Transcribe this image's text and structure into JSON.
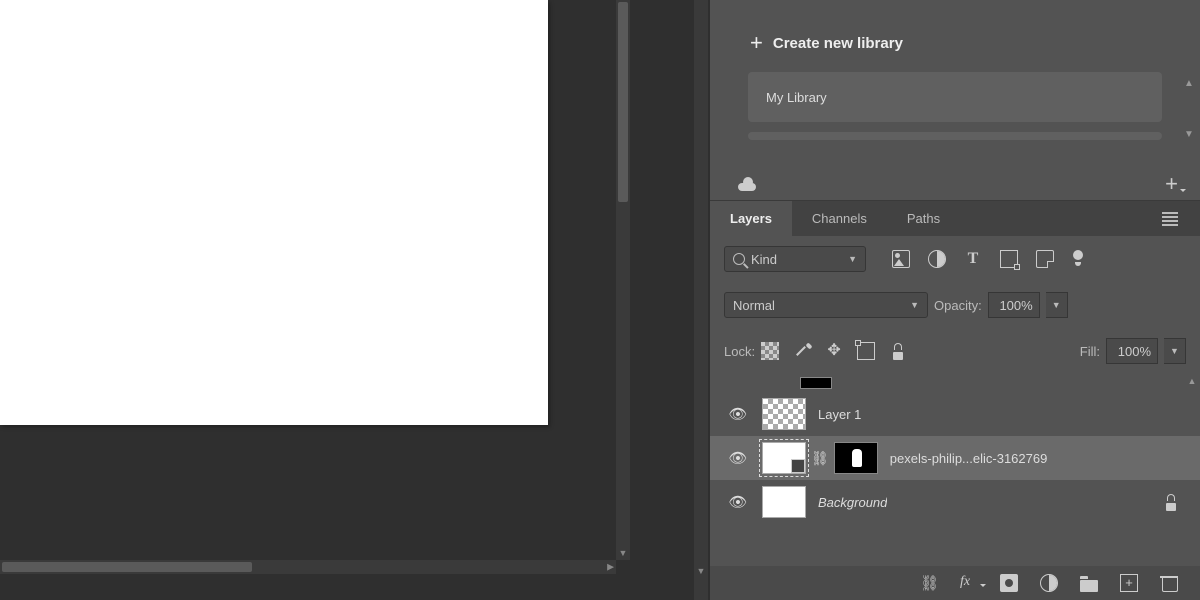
{
  "libraries": {
    "create_label": "Create new library",
    "items": [
      {
        "name": "My Library"
      }
    ]
  },
  "layers_panel": {
    "tabs": {
      "layers": "Layers",
      "channels": "Channels",
      "paths": "Paths"
    },
    "filter": {
      "kind_label": "Kind"
    },
    "blend": {
      "mode": "Normal",
      "opacity_label": "Opacity:",
      "opacity_value": "100%",
      "lock_label": "Lock:",
      "fill_label": "Fill:",
      "fill_value": "100%"
    },
    "layers": [
      {
        "name": "Layer 1",
        "visible": true,
        "type": "raster-transparent"
      },
      {
        "name": "pexels-philip...elic-3162769",
        "visible": true,
        "type": "smart-masked",
        "selected": true
      },
      {
        "name": "Background",
        "visible": true,
        "type": "background",
        "italic": true,
        "locked": true
      }
    ]
  }
}
